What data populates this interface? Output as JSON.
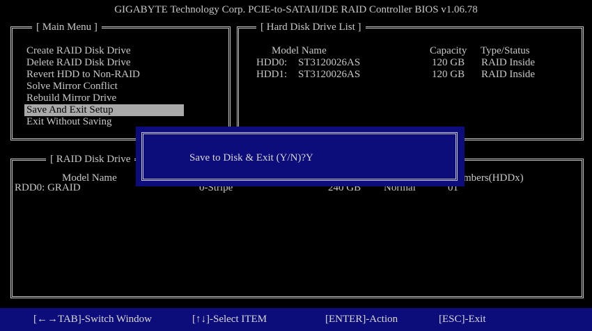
{
  "header": {
    "title": "GIGABYTE Technology Corp. PCIE-to-SATAII/IDE RAID Controller BIOS v1.06.78"
  },
  "main_menu": {
    "title": "[ Main Menu ]",
    "items": [
      "Create RAID Disk Drive",
      "Delete RAID Disk Drive",
      "Revert HDD to Non-RAID",
      "Solve Mirror Conflict",
      "Rebuild Mirror Drive",
      "Save And Exit Setup",
      "Exit Without Saving"
    ],
    "selected": "Save And Exit Setup"
  },
  "hdd_list": {
    "title": "[ Hard Disk Drive List ]",
    "headers": {
      "model": "Model Name",
      "capacity": "Capacity",
      "type": "Type/Status"
    },
    "rows": [
      {
        "id": "HDD0:",
        "model": "ST3120026AS",
        "capacity": "120 GB",
        "type": "RAID Inside"
      },
      {
        "id": "HDD1:",
        "model": "ST3120026AS",
        "capacity": "120 GB",
        "type": "RAID Inside"
      }
    ]
  },
  "raid_list": {
    "title": "[ RAID Disk Drive",
    "headers": {
      "model": "Model Name",
      "members": "mbers(HDDx)"
    },
    "rows": [
      {
        "id": "RDD0: GRAID",
        "level": "0-Stripe",
        "capacity": "240 GB",
        "status": "Normal",
        "members": "01"
      }
    ]
  },
  "dialog": {
    "text": "Save to Disk & Exit (Y/N)?Y"
  },
  "footer": {
    "switch": "[←→TAB]-Switch Window",
    "select": "[↑↓]-Select ITEM",
    "action": "[ENTER]-Action",
    "exit": "[ESC]-Exit"
  },
  "colors": {
    "background": "#000000",
    "footer": "#0c0c7a",
    "selection": "#a9a9a9",
    "text": "#c8c8c8"
  }
}
